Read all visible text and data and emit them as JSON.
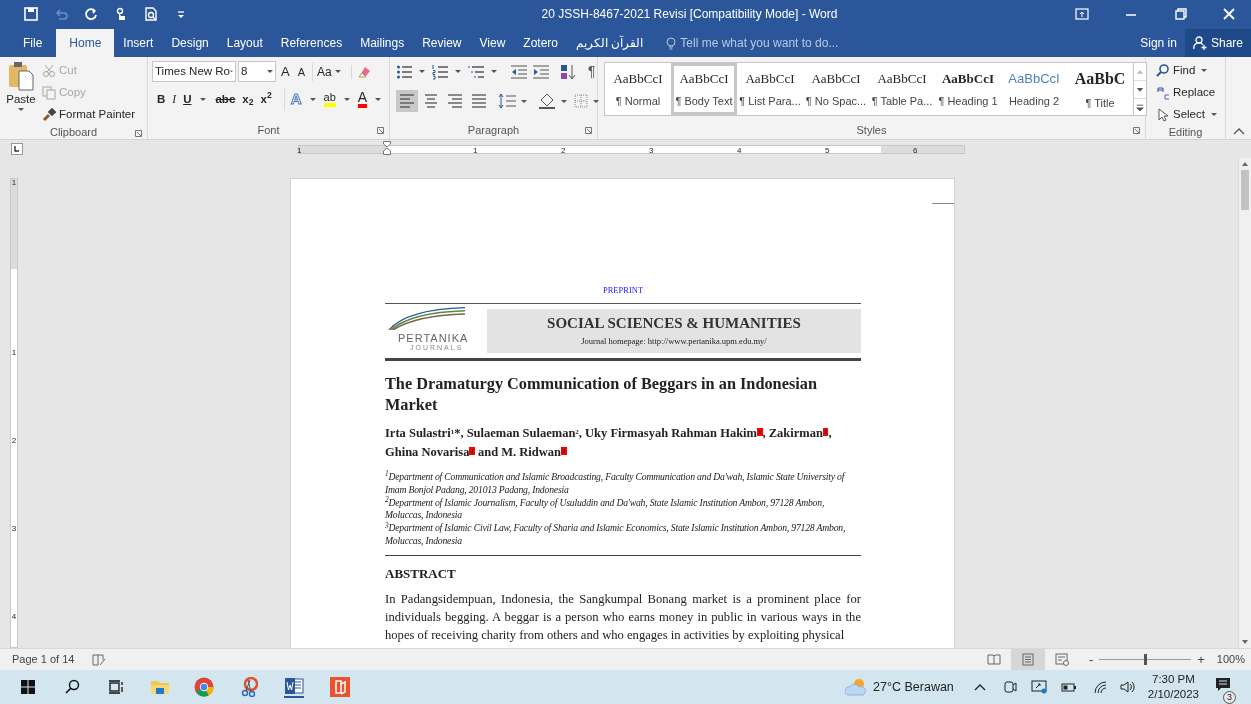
{
  "window": {
    "title": "20 JSSH-8467-2021 Revisi [Compatibility Mode] - Word"
  },
  "quick_access": [
    {
      "kind": "save",
      "disabled": false
    },
    {
      "kind": "undo",
      "disabled": true
    },
    {
      "kind": "repeat",
      "disabled": false
    },
    {
      "kind": "touch",
      "disabled": false
    },
    {
      "kind": "preview",
      "disabled": false
    },
    {
      "kind": "customize",
      "disabled": false
    }
  ],
  "tabs": [
    {
      "label": "File",
      "selected": false
    },
    {
      "label": "Home",
      "selected": true
    },
    {
      "label": "Insert",
      "selected": false
    },
    {
      "label": "Design",
      "selected": false
    },
    {
      "label": "Layout",
      "selected": false
    },
    {
      "label": "References",
      "selected": false
    },
    {
      "label": "Mailings",
      "selected": false
    },
    {
      "label": "Review",
      "selected": false
    },
    {
      "label": "View",
      "selected": false
    },
    {
      "label": "Zotero",
      "selected": false
    },
    {
      "label": "القرآن الكريم",
      "selected": false
    }
  ],
  "tell_me": {
    "placeholder": "Tell me what you want to do..."
  },
  "account": {
    "sign_in": "Sign in",
    "share": "Share"
  },
  "clipboard": {
    "group": "Clipboard",
    "paste": "Paste",
    "items": [
      {
        "kind": "cut",
        "label": "Cut",
        "disabled": true
      },
      {
        "kind": "copy",
        "label": "Copy",
        "disabled": true
      },
      {
        "kind": "painter",
        "label": "Format Painter",
        "disabled": false
      }
    ]
  },
  "font": {
    "group": "Font",
    "name": "Times New Ro",
    "size": "8",
    "grow": "A",
    "shrink": "A",
    "change_case": "Aa",
    "format_buttons": [
      {
        "kind": "bold",
        "label": "B"
      },
      {
        "kind": "italic",
        "label": "I"
      },
      {
        "kind": "underline",
        "label": "U"
      },
      {
        "kind": "strike",
        "label": "abc"
      },
      {
        "kind": "sub",
        "label": "x$_{2}$"
      },
      {
        "kind": "sup",
        "label": "x$^{2}$"
      }
    ],
    "effects": "A",
    "highlight": "ab",
    "font_color": "A"
  },
  "paragraph": {
    "group": "Paragraph",
    "show_marks": "¶",
    "alignments": [
      {
        "kind": "left",
        "selected": true
      },
      {
        "kind": "center",
        "selected": false
      },
      {
        "kind": "right",
        "selected": false
      },
      {
        "kind": "justify",
        "selected": false
      }
    ]
  },
  "styles": {
    "group": "Styles",
    "items": [
      {
        "kind": "normal",
        "preview": "AaBbCcI",
        "label": "¶ Normal",
        "selected": false
      },
      {
        "kind": "normal",
        "preview": "AaBbCcI",
        "label": "¶ Body Text",
        "selected": true
      },
      {
        "kind": "normal",
        "preview": "AaBbCcI",
        "label": "¶ List Para...",
        "selected": false
      },
      {
        "kind": "normal",
        "preview": "AaBbCcI",
        "label": "¶ No Spac...",
        "selected": false
      },
      {
        "kind": "normal",
        "preview": "AaBbCcI",
        "label": "¶ Table Pa...",
        "selected": false
      },
      {
        "kind": "heading1",
        "preview": "AaBbCcI",
        "label": "¶ Heading 1",
        "selected": false
      },
      {
        "kind": "heading2",
        "preview": "AaBbCcI",
        "label": "Heading 2",
        "selected": false
      },
      {
        "kind": "title",
        "preview": "AaBbC",
        "label": "¶ Title",
        "selected": false
      }
    ]
  },
  "editing": {
    "group": "Editing",
    "items": [
      {
        "kind": "find",
        "label": "Find"
      },
      {
        "kind": "replace",
        "label": "Replace"
      },
      {
        "kind": "select",
        "label": "Select"
      }
    ]
  },
  "ruler": {
    "labels": [
      "1",
      "1",
      "2",
      "3",
      "4",
      "5",
      "6"
    ],
    "vertical_labels": [
      "1",
      "1",
      "2",
      "3",
      "4"
    ]
  },
  "document": {
    "preprint": "PREPRINT",
    "logo": "PERTANIKA",
    "logo_sub": "JOURNALS",
    "journal": "SOCIAL SCIENCES & HUMANITIES",
    "homepage": "Journal homepage: http://www.pertanika.upm.edu.my/",
    "title": "The Dramaturgy Communication of Beggars in an Indonesian Market",
    "authors": [
      {
        "name": "Irta Sulastri",
        "sup": "1",
        "suffix": "*,",
        "highlighted": false
      },
      {
        "name": "Sulaeman Sulaeman",
        "sup": "2",
        "suffix": ",",
        "highlighted": false
      },
      {
        "name": "Uky Firmasyah Rahman Hakim",
        "sup": "1",
        "suffix": ",",
        "highlighted": true
      },
      {
        "name": "Zakirman",
        "sup": "1",
        "suffix": ",",
        "highlighted": true
      },
      {
        "name": "Ghina Novarisa",
        "sup": "1",
        "suffix": " and",
        "highlighted": true
      },
      {
        "name": "M. Ridwan",
        "sup": "3",
        "highlighted": true
      }
    ],
    "affiliations": [
      "$^{1}$Department of Communication and Islamic Broadcasting, Faculty Communication and Da'wah, Islamic State University of Imam Bonjol Padang, 201013 Padang, Indonesia",
      "$^{2}$Department of Islamic Journalism, Faculty of Usuluddin and Da'wah, State Islamic Institution Ambon, 97128 Ambon, Moluccas, Indonesia",
      "$^{3}$Department of Islamic Civil Law, Faculty of Sharia and Islamic Economics, State Islamic Institution Ambon, 97128 Ambon, Moluccas, Indonesia"
    ],
    "abstract_heading": "ABSTRACT",
    "abstract": "In Padangsidempuan, Indonesia, the Sangkumpal Bonang market is a prominent place for individuals begging. A beggar is a person who earns money in public in various ways in the hopes of receiving charity from others and who engages in activities by exploiting physical"
  },
  "status_bar": {
    "page": "Page 1 of 14",
    "views": [
      {
        "kind": "read",
        "selected": false
      },
      {
        "kind": "print",
        "selected": true
      },
      {
        "kind": "web",
        "selected": false
      }
    ],
    "zoom_out": "-",
    "zoom_in": "+",
    "zoom": {
      "level": 0.5
    },
    "zoom_label": "100%"
  },
  "taskbar": {
    "weather": "27°C Berawan",
    "time": "7:30 PM",
    "date": "2/10/2023",
    "notifications": "3"
  }
}
